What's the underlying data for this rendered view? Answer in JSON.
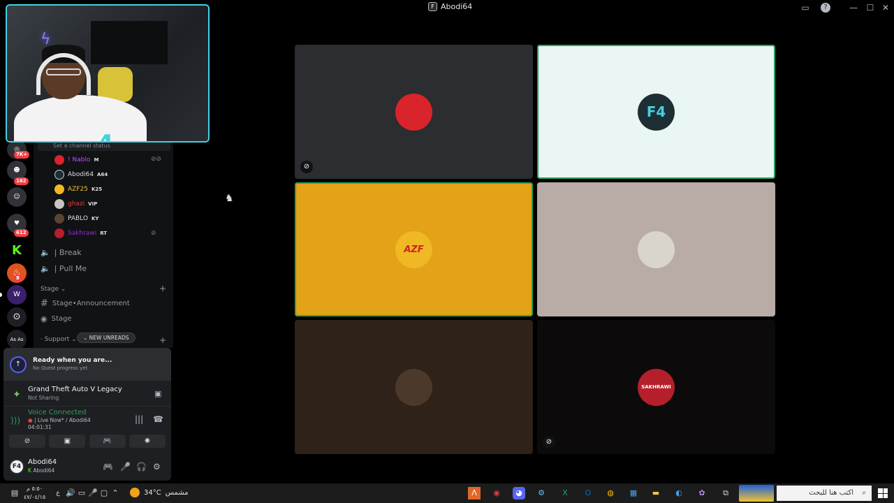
{
  "window": {
    "title": "Abodi64"
  },
  "titlebar": {
    "inbox_icon": "inbox-icon",
    "help_icon": "help-icon"
  },
  "guild_rail": {
    "badges": [
      "7K+",
      "162",
      "612",
      "8"
    ]
  },
  "channels": {
    "topic_placeholder": "Set a channel status",
    "members": [
      {
        "name": "! Nablo",
        "tag": "M",
        "color": "#c44bff"
      },
      {
        "name": "Abodi64",
        "tag": "A64",
        "color": "#dbdee1"
      },
      {
        "name": "AZF25",
        "tag": "K25",
        "color": "#f0c22f"
      },
      {
        "name": "ghazi",
        "tag": "VIP",
        "color": "#e03d3d"
      },
      {
        "name": "PABLO",
        "tag": "KY",
        "color": "#dbdee1"
      },
      {
        "name": "Sakhrawi",
        "tag": "RT",
        "color": "#8b2fc9"
      }
    ],
    "voice_channels": [
      {
        "label": "| Break"
      },
      {
        "label": "| Pull Me"
      }
    ],
    "categories": {
      "stage": "Stage",
      "support": "Support"
    },
    "text_channels": [
      {
        "label": "Stage•Announcement"
      },
      {
        "label": "Stage"
      }
    ],
    "new_unreads": "NEW UNREADS"
  },
  "panel": {
    "quest_title": "Ready when you are...",
    "quest_sub": "No Quest progress yet",
    "activity_title": "Grand Theft Auto V Legacy",
    "activity_sub": "Not Sharing",
    "voice_status": "Voice Connected",
    "voice_channel": "| Live Now* / Abodi64",
    "voice_timer": "04:01:31",
    "user_name": "Abodi64",
    "user_sub": "Abodi64"
  },
  "tiles": [
    {
      "id": "tile-1",
      "bg": "#2b2d31",
      "speaking": false,
      "muted": true,
      "avatar_bg": "#d8242a",
      "avatar_text": ""
    },
    {
      "id": "tile-2",
      "bg": "#eaf6f3",
      "speaking": true,
      "muted": false,
      "avatar_bg": "#1d2e35",
      "avatar_text": "F4"
    },
    {
      "id": "tile-3",
      "bg": "#e3a218",
      "speaking": true,
      "muted": false,
      "avatar_bg": "#f0b824",
      "avatar_text": "AZF"
    },
    {
      "id": "tile-4",
      "bg": "#b9aba5",
      "speaking": false,
      "muted": false,
      "avatar_bg": "#d9d4cc",
      "avatar_text": ""
    },
    {
      "id": "tile-5",
      "bg": "#2e2219",
      "speaking": false,
      "muted": false,
      "avatar_bg": "#4b3a2c",
      "avatar_text": ""
    },
    {
      "id": "tile-6",
      "bg": "#0d0a0b",
      "speaking": false,
      "muted": true,
      "avatar_bg": "#b51f2b",
      "avatar_text": "SAKHRAWI"
    }
  ],
  "taskbar": {
    "time": "٥:٥٠ م",
    "date": "٤٧/٠٤/١٥",
    "temperature": "34°C",
    "weather": "مشمس",
    "search_placeholder": "اكتب هنا للبحث",
    "lang": "ع"
  },
  "colors": {
    "accent": "#5865f2",
    "online": "#23a55a",
    "danger": "#f23f43",
    "cam_border": "#43d0e6"
  }
}
